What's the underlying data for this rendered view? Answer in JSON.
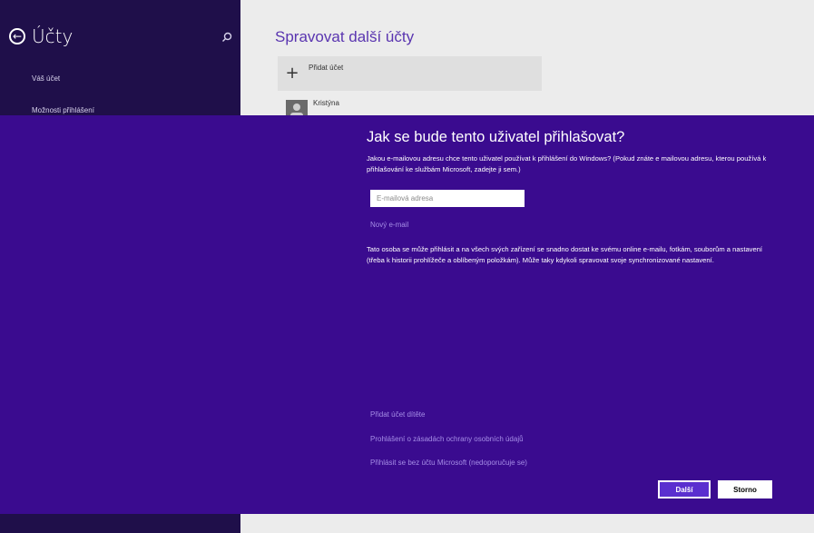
{
  "sidebar": {
    "title": "Účty",
    "items": [
      "Váš účet",
      "Možnosti přihlášení"
    ]
  },
  "main": {
    "section_title": "Spravovat další účty",
    "add_account_label": "Přidat účet",
    "user_name": "Kristýna"
  },
  "dialog": {
    "heading": "Jak se bude tento uživatel přihlašovat?",
    "description": "Jakou e-mailovou adresu chce tento uživatel používat k přihlášení do Windows? (Pokud znáte e mailovou adresu, kterou používá k přihlašování ke službám Microsoft, zadejte ji sem.)",
    "email_placeholder": "E-mailová adresa",
    "new_email_link": "Nový e-mail",
    "info_text": "Tato osoba se může přihlásit a na všech svých zařízení se snadno dostat ke svému online e-mailu, fotkám, souborům a nastavení (třeba k historii prohlížeče a oblíbeným položkám). Může taky kdykoli spravovat svoje synchronizované nastavení.",
    "links": [
      "Přidat účet dítěte",
      "Prohlášení o zásadách ochrany osobních údajů",
      "Přihlásit se bez účtu Microsoft (nedoporučuje se)"
    ],
    "next_button": "Další",
    "cancel_button": "Storno"
  },
  "colors": {
    "flyout_bg": "#3a0b8f",
    "sidebar_bg": "#1f0f4a",
    "accent": "#5a2fcf",
    "link": "#a58de6"
  }
}
